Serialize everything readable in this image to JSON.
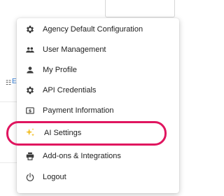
{
  "background": {
    "link_text": "E"
  },
  "menu": {
    "items": [
      {
        "label": "Agency Default Configuration",
        "icon": "gear-icon"
      },
      {
        "label": "User Management",
        "icon": "people-icon"
      },
      {
        "label": "My Profile",
        "icon": "person-icon"
      },
      {
        "label": "API Credentials",
        "icon": "gear-icon"
      },
      {
        "label": "Payment Information",
        "icon": "payment-icon"
      },
      {
        "label": "AI Settings",
        "icon": "sparkle-icon"
      },
      {
        "label": "Add-ons & Integrations",
        "icon": "printer-icon"
      },
      {
        "label": "Logout",
        "icon": "power-icon"
      }
    ]
  },
  "colors": {
    "highlight": "#e0155f",
    "icon": "#3c3c3c",
    "sparkle": "#f2c12e",
    "text": "#212121"
  }
}
